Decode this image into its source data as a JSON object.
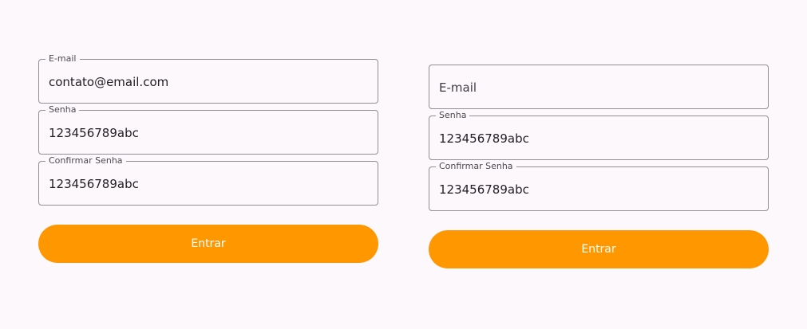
{
  "left_form": {
    "email": {
      "label": "E-mail",
      "value": "contato@email.com"
    },
    "password": {
      "label": "Senha",
      "value": "123456789abc"
    },
    "confirm": {
      "label": "Confirmar Senha",
      "value": "123456789abc"
    },
    "submit_label": "Entrar"
  },
  "right_form": {
    "email": {
      "placeholder": "E-mail"
    },
    "password": {
      "label": "Senha",
      "value": "123456789abc"
    },
    "confirm": {
      "label": "Confirmar Senha",
      "value": "123456789abc"
    },
    "submit_label": "Entrar"
  },
  "colors": {
    "background": "#fdf8fc",
    "accent": "#ff9800",
    "border": "#8f8f95"
  }
}
